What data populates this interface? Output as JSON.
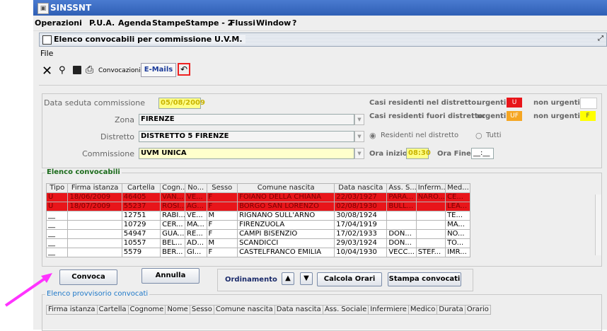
{
  "app": {
    "title": "SINSSNT"
  },
  "menu": [
    "Operazioni",
    "P.U.A.",
    "Agenda",
    "Stampe",
    "Stampe - 2",
    "Flussi",
    "Window",
    "?"
  ],
  "window": {
    "title": "Elenco convocabili per commissione U.V.M.",
    "file_menu": "File"
  },
  "toolbar": {
    "convocazioni_label": "Convocazioni",
    "emails_label": "E-Mails",
    "close_icon": "close-icon",
    "search_icon": "binoculars-icon",
    "save_icon": "floppy-icon",
    "print_icon": "printer-icon",
    "undo_icon": "undo-icon"
  },
  "form": {
    "data_label": "Data seduta commissione",
    "data_value": "05/08/2009",
    "zona_label": "Zona",
    "zona_value": "FIRENZE",
    "distretto_label": "Distretto",
    "distretto_value": "DISTRETTO 5 FIRENZE",
    "commissione_label": "Commissione",
    "commissione_value": "UVM UNICA",
    "casi_res_label": "Casi residenti nel distretto:",
    "casi_fuori_label": "Casi residenti fuori distretto:",
    "urgenti_label": "urgenti",
    "non_urgenti_label": "non urgenti",
    "swatch_u": "U",
    "swatch_uf": "UF",
    "swatch_f": "F",
    "radio_res": "Residenti nel distretto",
    "radio_tutti": "Tutti",
    "ora_inizio_label": "Ora inizio",
    "ora_inizio_value": "08:30",
    "ora_fine_label": "Ora Fine",
    "ora_fine_value": "__:__",
    "colors": {
      "red": "#e8151a",
      "orange": "#f5a623",
      "yellow": "#ffff00"
    }
  },
  "grid1": {
    "title": "Elenco convocabili",
    "columns": [
      "Tipo",
      "Firma istanza",
      "Cartella",
      "Cogn...",
      "No...",
      "Sesso",
      "Comune nascita",
      "Data nascita",
      "Ass. S...",
      "Inferm...",
      "Med..."
    ],
    "rows": [
      [
        "U",
        "18/06/2009",
        "46405",
        "VAN...",
        "VE...",
        "F",
        "FOIANO DELLA CHIANA",
        "22/03/1927",
        "PARA...",
        "NARO...",
        "CE..."
      ],
      [
        "U",
        "18/07/2009",
        "55237",
        "ROSI...",
        "AG...",
        "F",
        "BORGO SAN LORENZO",
        "02/08/1930",
        "BULL...",
        "",
        "LEA..."
      ],
      [
        "__",
        "",
        "12751",
        "RABI...",
        "VE...",
        "M",
        "RIGNANO SULL'ARNO",
        "30/08/1924",
        "",
        "",
        "TE..."
      ],
      [
        "__",
        "",
        "10729",
        "CER...",
        "MA...",
        "F",
        "FIRENZUOLA",
        "17/04/1919",
        "",
        "",
        "MA..."
      ],
      [
        "__",
        "",
        "54947",
        "GUA...",
        "RE...",
        "F",
        "CAMPI BISENZIO",
        "17/02/1933",
        "DON...",
        "",
        "NO..."
      ],
      [
        "__",
        "",
        "10557",
        "BEL...",
        "AD...",
        "M",
        "SCANDICCI",
        "29/03/1924",
        "DON...",
        "",
        "TO..."
      ],
      [
        "__",
        "",
        "5579",
        "BER...",
        "GI...",
        "F",
        "CASTELFRANCO EMILIA",
        "10/04/1930",
        "VECC...",
        "STEF...",
        "IMR..."
      ]
    ]
  },
  "buttons": {
    "convoca": "Convoca",
    "annulla": "Annulla",
    "ordinamento": "Ordinamento",
    "calcola": "Calcola Orari",
    "stampa": "Stampa convocati"
  },
  "grid2": {
    "title": "Elenco provvisorio convocati",
    "columns": [
      "Firma istanza",
      "Cartella",
      "Cognome",
      "Nome",
      "Sesso",
      "Comune nascita",
      "Data nascita",
      "Ass. Sociale",
      "Infermiere",
      "Medico",
      "Durata",
      "Orario"
    ]
  }
}
